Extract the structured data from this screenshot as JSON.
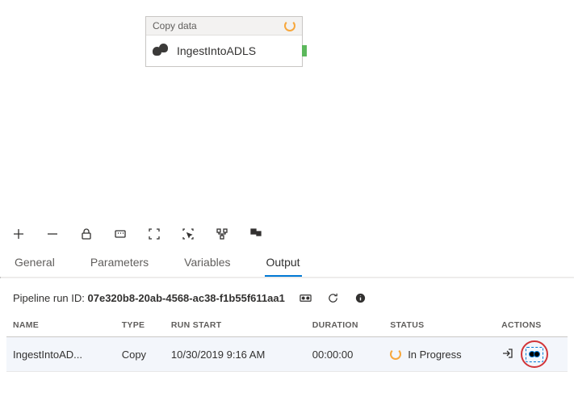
{
  "activity": {
    "type_label": "Copy data",
    "name": "IngestIntoADLS"
  },
  "toolbar": {
    "items": [
      "add",
      "remove",
      "lock",
      "zoom-100",
      "fullscreen",
      "select",
      "autolayout",
      "minimap"
    ]
  },
  "tabs": {
    "items": [
      {
        "label": "General"
      },
      {
        "label": "Parameters"
      },
      {
        "label": "Variables"
      },
      {
        "label": "Output",
        "active": true
      }
    ]
  },
  "run": {
    "label": "Pipeline run ID:",
    "id": "07e320b8-20ab-4568-ac38-f1b55f611aa1"
  },
  "table": {
    "headers": {
      "name": "NAME",
      "type": "TYPE",
      "run_start": "RUN START",
      "duration": "DURATION",
      "status": "STATUS",
      "actions": "ACTIONS"
    },
    "rows": [
      {
        "name": "IngestIntoAD...",
        "type": "Copy",
        "run_start": "10/30/2019 9:16 AM",
        "duration": "00:00:00",
        "status": "In Progress"
      }
    ]
  }
}
